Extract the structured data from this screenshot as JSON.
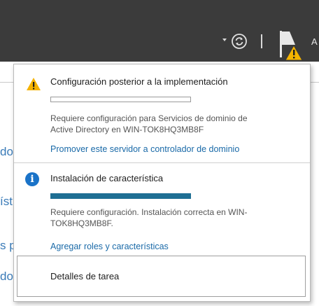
{
  "header": {
    "partial_label": "A",
    "icons": [
      "chevron-down-icon",
      "refresh-icon",
      "notifications-flag-icon",
      "warning-icon"
    ]
  },
  "background": {
    "fragments": [
      "do",
      "íst",
      "s p",
      "do"
    ]
  },
  "notifications": [
    {
      "icon": "warning-icon",
      "title": "Configuración posterior a la implementación",
      "progress": 0,
      "body_lines": [
        "Requiere configuración para Servicios de dominio de",
        "Active Directory en WIN-TOK8HQ3MB8F"
      ],
      "link": "Promover este servidor a controlador de dominio"
    },
    {
      "icon": "info-icon",
      "title": "Instalación de característica",
      "progress": 1,
      "body_lines": [
        "Requiere configuración. Instalación correcta en WIN-",
        "TOK8HQ3MB8F."
      ],
      "link": "Agregar roles y características"
    }
  ],
  "task_details": {
    "label": "Detalles de tarea"
  },
  "colors": {
    "header_bg": "#3b3b3b",
    "link": "#1a6aa8",
    "progress_fill": "#1f6f94",
    "warning": "#f5b300",
    "info": "#1a73c8"
  }
}
